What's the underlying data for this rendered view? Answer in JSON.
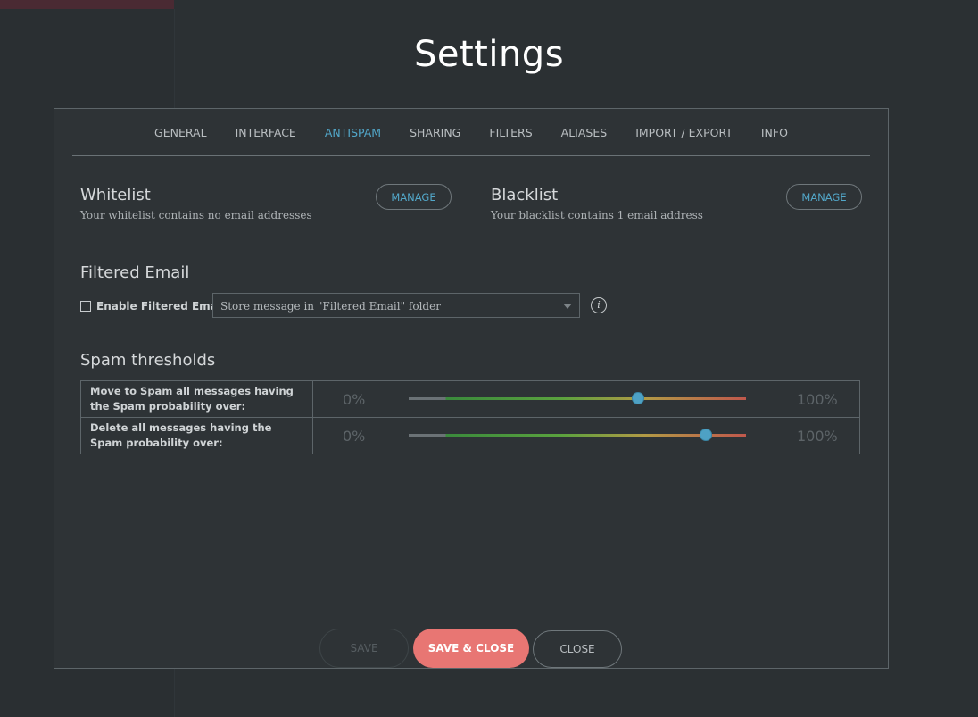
{
  "page_title": "Settings",
  "tabs": [
    {
      "label": "GENERAL",
      "active": false
    },
    {
      "label": "INTERFACE",
      "active": false
    },
    {
      "label": "ANTISPAM",
      "active": true
    },
    {
      "label": "SHARING",
      "active": false
    },
    {
      "label": "FILTERS",
      "active": false
    },
    {
      "label": "ALIASES",
      "active": false
    },
    {
      "label": "IMPORT / EXPORT",
      "active": false
    },
    {
      "label": "INFO",
      "active": false
    }
  ],
  "whitelist": {
    "title": "Whitelist",
    "subtitle": "Your whitelist contains no email addresses",
    "button": "MANAGE"
  },
  "blacklist": {
    "title": "Blacklist",
    "subtitle": "Your blacklist contains 1 email address",
    "button": "MANAGE"
  },
  "filtered_email": {
    "title": "Filtered Email",
    "checkbox_label": "Enable Filtered Email",
    "checked": false,
    "select_value": "Store message in \"Filtered Email\" folder",
    "info_glyph": "i"
  },
  "spam_thresholds": {
    "title": "Spam thresholds",
    "rows": [
      {
        "label": "Move to Spam all messages having the Spam probability over:",
        "min_label": "0%",
        "max_label": "100%",
        "value": 0.68
      },
      {
        "label": "Delete all messages having the Spam probability over:",
        "min_label": "0%",
        "max_label": "100%",
        "value": 0.88
      }
    ]
  },
  "footer": {
    "save": "SAVE",
    "save_close": "SAVE & CLOSE",
    "close": "CLOSE"
  },
  "colors": {
    "accent": "#52a7c9",
    "primary_button": "#e87673",
    "slider_knob": "#4ea1c4"
  }
}
